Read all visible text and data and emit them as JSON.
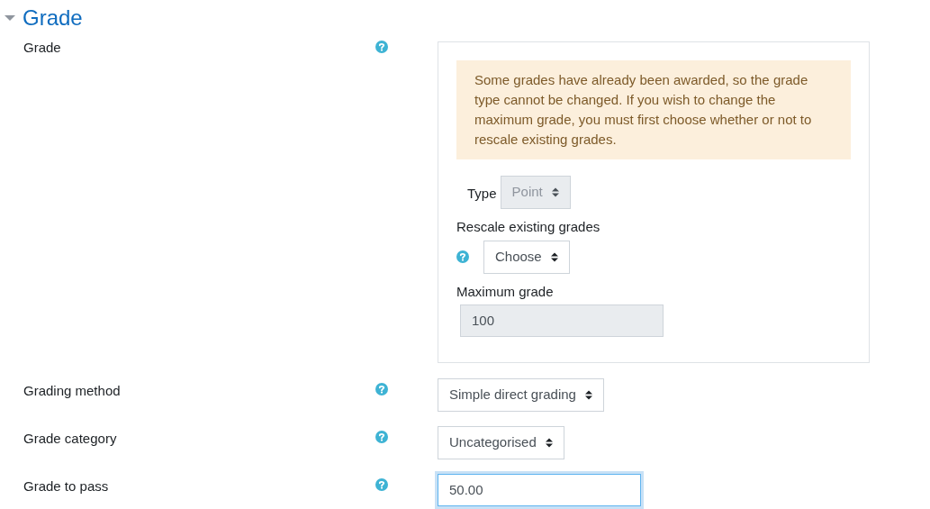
{
  "section": {
    "title": "Grade",
    "expanded": true
  },
  "grade": {
    "label": "Grade",
    "alert": "Some grades have already been awarded, so the grade type cannot be changed. If you wish to change the maximum grade, you must first choose whether or not to rescale existing grades.",
    "type_label": "Type",
    "type_select": {
      "value": "Point",
      "disabled": true
    },
    "rescale_label": "Rescale existing grades",
    "rescale_select": {
      "value": "Choose",
      "disabled": false
    },
    "max_label": "Maximum grade",
    "max_input": {
      "value": "100",
      "disabled": true
    }
  },
  "fields": [
    {
      "label": "Grading method",
      "kind": "select",
      "value": "Simple direct grading"
    },
    {
      "label": "Grade category",
      "kind": "select",
      "value": "Uncategorised"
    },
    {
      "label": "Grade to pass",
      "kind": "input",
      "value": "50.00",
      "focused": true
    }
  ]
}
